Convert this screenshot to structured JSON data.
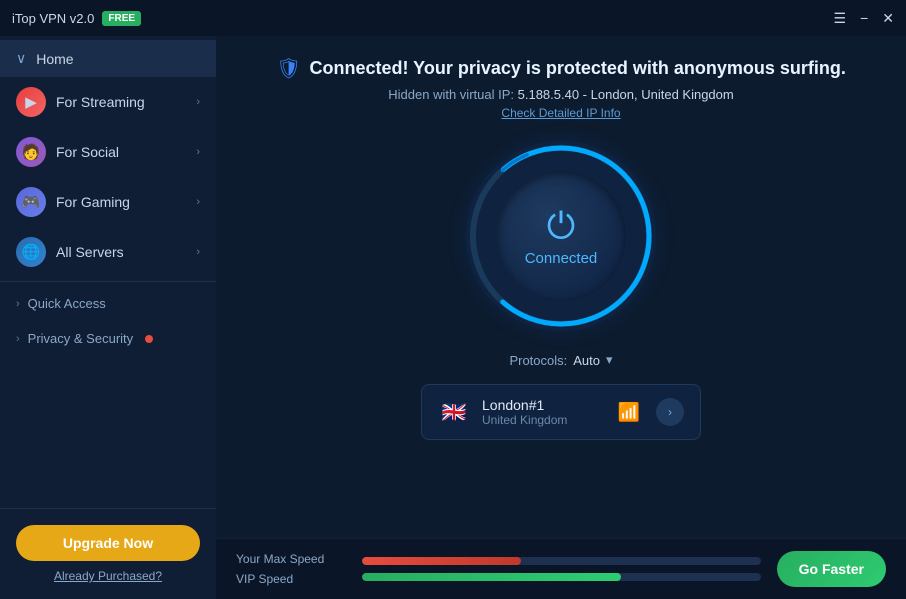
{
  "titlebar": {
    "title": "iTop VPN v2.0",
    "free_badge": "FREE",
    "minimize_label": "−",
    "maximize_label": "⊡",
    "close_label": "✕"
  },
  "sidebar": {
    "home_label": "Home",
    "items": [
      {
        "id": "streaming",
        "label": "For Streaming",
        "icon": "▶",
        "icon_class": "icon-streaming"
      },
      {
        "id": "social",
        "label": "For Social",
        "icon": "👤",
        "icon_class": "icon-social"
      },
      {
        "id": "gaming",
        "label": "For Gaming",
        "icon": "🎮",
        "icon_class": "icon-gaming"
      },
      {
        "id": "servers",
        "label": "All Servers",
        "icon": "🌐",
        "icon_class": "icon-servers"
      }
    ],
    "sections": [
      {
        "id": "quick-access",
        "label": "Quick Access",
        "has_dot": false
      },
      {
        "id": "privacy-security",
        "label": "Privacy & Security",
        "has_dot": true
      }
    ],
    "upgrade_btn_label": "Upgrade Now",
    "purchased_link_label": "Already Purchased?"
  },
  "main": {
    "status_icon": "🛡",
    "status_text": "Connected! Your privacy is protected with anonymous surfing.",
    "ip_label": "Hidden with virtual IP:",
    "ip_value": "5.188.5.40 - London, United Kingdom",
    "ip_link_label": "Check Detailed IP Info",
    "power_label": "Connected",
    "protocols_label": "Protocols:",
    "protocols_value": "Auto",
    "server": {
      "flag": "🇬🇧",
      "name": "London#1",
      "country": "United Kingdom"
    },
    "speed": {
      "max_speed_label": "Your Max Speed",
      "vip_speed_label": "VIP Speed",
      "go_faster_label": "Go Faster"
    }
  }
}
